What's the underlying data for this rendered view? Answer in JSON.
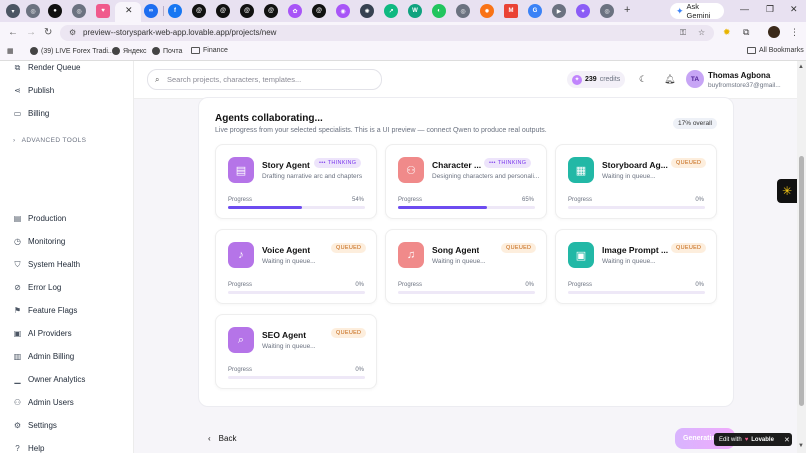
{
  "browser": {
    "tab_icons": [
      "chrome-icon",
      "github-icon",
      "chrome-icon",
      "lovable-icon",
      "close-icon",
      "meta-icon",
      "facebook-icon",
      "threads-icon",
      "threads-icon",
      "threads-icon",
      "ai-icon",
      "threads-icon",
      "ai-icon",
      "openai-icon",
      "app-icon",
      "chatgpt-icon",
      "app-icon",
      "app-icon",
      "gmail-icon",
      "app-icon",
      "app-icon",
      "chrome-icon"
    ],
    "ask_gemini": "Ask Gemini",
    "url": "preview--storyspark-web-app.lovable.app/projects/new",
    "bookmarks": [
      "(39) LIVE Forex Tradi...",
      "Яндекс",
      "Почта",
      "Finance"
    ],
    "all_bookmarks": "All Bookmarks"
  },
  "sidebar": {
    "top_items": [
      {
        "label": "Render Queue",
        "icon": "layers-icon"
      },
      {
        "label": "Publish",
        "icon": "share-icon"
      },
      {
        "label": "Billing",
        "icon": "card-icon"
      }
    ],
    "section_label": "ADVANCED TOOLS",
    "admin_items": [
      {
        "label": "Production",
        "icon": "server-icon"
      },
      {
        "label": "Monitoring",
        "icon": "activity-icon"
      },
      {
        "label": "System Health",
        "icon": "shield-icon"
      },
      {
        "label": "Error Log",
        "icon": "alert-icon"
      },
      {
        "label": "Feature Flags",
        "icon": "flag-icon"
      },
      {
        "label": "AI Providers",
        "icon": "cpu-icon"
      },
      {
        "label": "Admin Billing",
        "icon": "receipt-icon"
      },
      {
        "label": "Owner Analytics",
        "icon": "chart-icon"
      },
      {
        "label": "Admin Users",
        "icon": "users-icon"
      },
      {
        "label": "Settings",
        "icon": "gear-icon"
      },
      {
        "label": "Help",
        "icon": "help-icon"
      }
    ]
  },
  "topbar": {
    "search_placeholder": "Search projects, characters, templates...",
    "credits_value": "239",
    "credits_label": "credits",
    "avatar_initials": "TA",
    "user_name": "Thomas Agbona",
    "user_email": "buyfromstore37@gmail..."
  },
  "panel": {
    "title": "Agents collaborating...",
    "subtitle": "Live progress from your selected specialists. This is a UI preview — connect Qwen to produce real outputs.",
    "overall": "17% overall",
    "progress_label": "Progress",
    "agents": [
      {
        "name": "Story Agent",
        "status": "THINKING",
        "desc": "Drafting narrative arc and chapters",
        "progress": 54,
        "progress_text": "54%",
        "color": "#b574e8",
        "icon": "book-icon"
      },
      {
        "name": "Character ...",
        "status": "THINKING",
        "desc": "Designing characters and personali...",
        "progress": 65,
        "progress_text": "65%",
        "color": "#f08a8a",
        "icon": "users-icon"
      },
      {
        "name": "Storyboard Ag...",
        "status": "QUEUED",
        "desc": "Waiting in queue...",
        "progress": 0,
        "progress_text": "0%",
        "color": "#22b8a6",
        "icon": "film-icon"
      },
      {
        "name": "Voice Agent",
        "status": "QUEUED",
        "desc": "Waiting in queue...",
        "progress": 0,
        "progress_text": "0%",
        "color": "#b574e8",
        "icon": "mic-icon"
      },
      {
        "name": "Song Agent",
        "status": "QUEUED",
        "desc": "Waiting in queue...",
        "progress": 0,
        "progress_text": "0%",
        "color": "#f08a8a",
        "icon": "music-icon"
      },
      {
        "name": "Image Prompt ...",
        "status": "QUEUED",
        "desc": "Waiting in queue...",
        "progress": 0,
        "progress_text": "0%",
        "color": "#22b8a6",
        "icon": "image-icon"
      },
      {
        "name": "SEO Agent",
        "status": "QUEUED",
        "desc": "Waiting in queue...",
        "progress": 0,
        "progress_text": "0%",
        "color": "#b574e8",
        "icon": "search-icon"
      }
    ]
  },
  "footer": {
    "back_label": "Back",
    "generate_label": "Generating...",
    "lovable_prefix": "Edit with",
    "lovable_brand": "Lovable"
  }
}
